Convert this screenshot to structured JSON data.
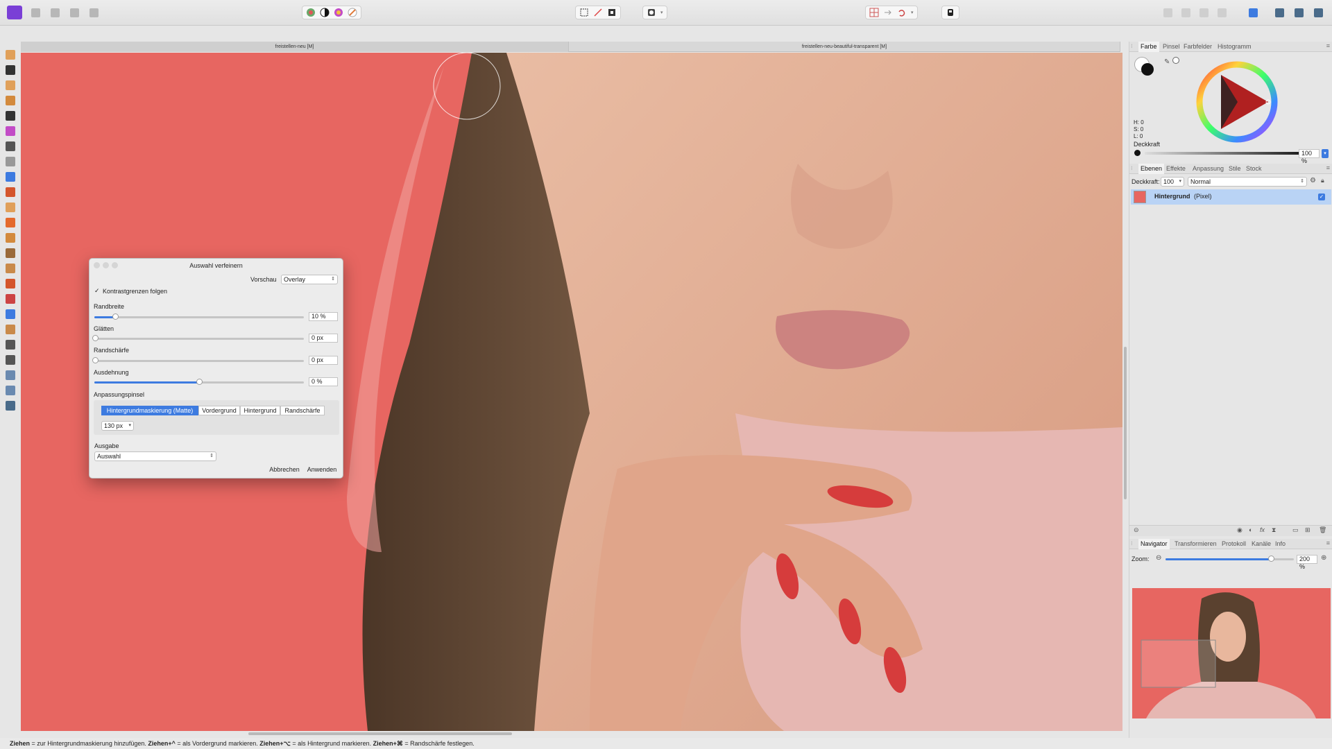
{
  "document_tabs": [
    {
      "label": "freistellen-neu [M]",
      "active": true
    },
    {
      "label": "freistellen-neu-beautiful-transparent [M]",
      "active": false
    }
  ],
  "dialog": {
    "title": "Auswahl verfeinern",
    "preview_label": "Vorschau",
    "preview_value": "Overlay",
    "follow_edges_label": "Kontrastgrenzen folgen",
    "follow_edges_checked": true,
    "sliders": [
      {
        "label": "Randbreite",
        "value": "10 %",
        "fraction": 0.1
      },
      {
        "label": "Glätten",
        "value": "0 px",
        "fraction": 0
      },
      {
        "label": "Randschärfe",
        "value": "0 px",
        "fraction": 0
      },
      {
        "label": "Ausdehnung",
        "value": "0 %",
        "fraction": 0.5
      }
    ],
    "brush_section_label": "Anpassungspinsel",
    "brush_modes": [
      {
        "label": "Hintergrundmaskierung (Matte)",
        "active": true
      },
      {
        "label": "Vordergrund",
        "active": false
      },
      {
        "label": "Hintergrund",
        "active": false
      },
      {
        "label": "Randschärfe",
        "active": false
      }
    ],
    "brush_size": "130 px",
    "output_label": "Ausgabe",
    "output_value": "Auswahl",
    "cancel_label": "Abbrechen",
    "apply_label": "Anwenden"
  },
  "color_panel": {
    "tabs": [
      "Farbe",
      "Pinsel",
      "Farbfelder",
      "Histogramm"
    ],
    "h": "H: 0",
    "s": "S: 0",
    "l": "L: 0",
    "opacity_label": "Deckkraft",
    "opacity_value": "100 %"
  },
  "layers_panel": {
    "tabs": [
      "Ebenen",
      "Effekte",
      "Anpassung",
      "Stile",
      "Stock"
    ],
    "opacity_label": "Deckkraft:",
    "opacity_value": "100",
    "blend_mode": "Normal",
    "layers": [
      {
        "name": "Hintergrund",
        "type": "(Pixel)",
        "visible": true
      }
    ]
  },
  "navigator_panel": {
    "tabs": [
      "Navigator",
      "Transformieren",
      "Protokoll",
      "Kanäle",
      "Info"
    ],
    "zoom_label": "Zoom:",
    "zoom_value": "200 %",
    "zoom_fraction": 0.82
  },
  "status_bar": {
    "k1": "Ziehen",
    "t1": " = zur Hintergrundmaskierung hinzufügen. ",
    "k2": "Ziehen+^",
    "t2": " = als Vordergrund markieren. ",
    "k3": "Ziehen+⌥",
    "t3": " = als Hintergrund markieren. ",
    "k4": "Ziehen+⌘",
    "t4": " = Randschärfe festlegen."
  },
  "colors": {
    "overlay_red": "#e76661",
    "accent_blue": "#3d7be0",
    "skin": "#e8b79d",
    "hair": "#7a5a42",
    "lips": "#c87a7a",
    "nail": "#d63c3c",
    "shirt": "#e6b7b2"
  }
}
